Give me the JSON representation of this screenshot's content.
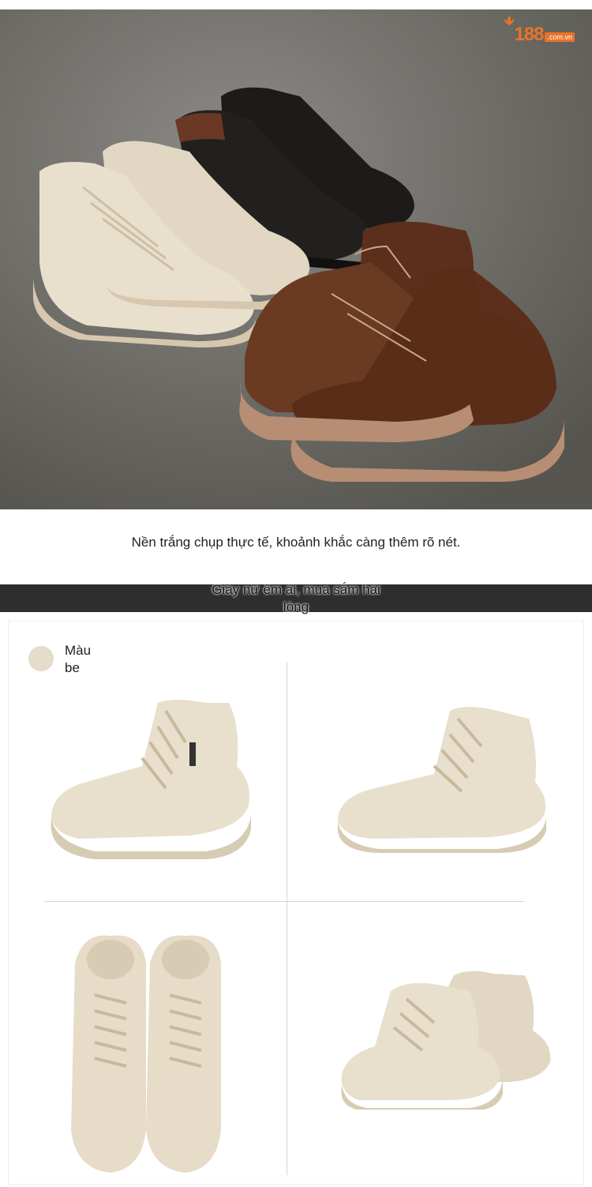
{
  "logo": {
    "number": "188",
    "domain": ".com.vn",
    "brand_color": "#e8742a"
  },
  "caption": {
    "text": "Nền trắng chụp thực tế, khoảnh khắc càng thêm rõ nét."
  },
  "banner": {
    "text": "Giày nữ êm ái, mua sắm hài lòng"
  },
  "color_option": {
    "label": "Màu be",
    "swatch_color": "#e5dccb"
  },
  "colors": {
    "beige": "#e6dccb",
    "black": "#1d1b1a",
    "brown": "#6a3a22",
    "sole_beige": "#d9ccb6",
    "sole_brown": "#b78e74"
  },
  "icons": [
    "leaf-logo-icon"
  ]
}
